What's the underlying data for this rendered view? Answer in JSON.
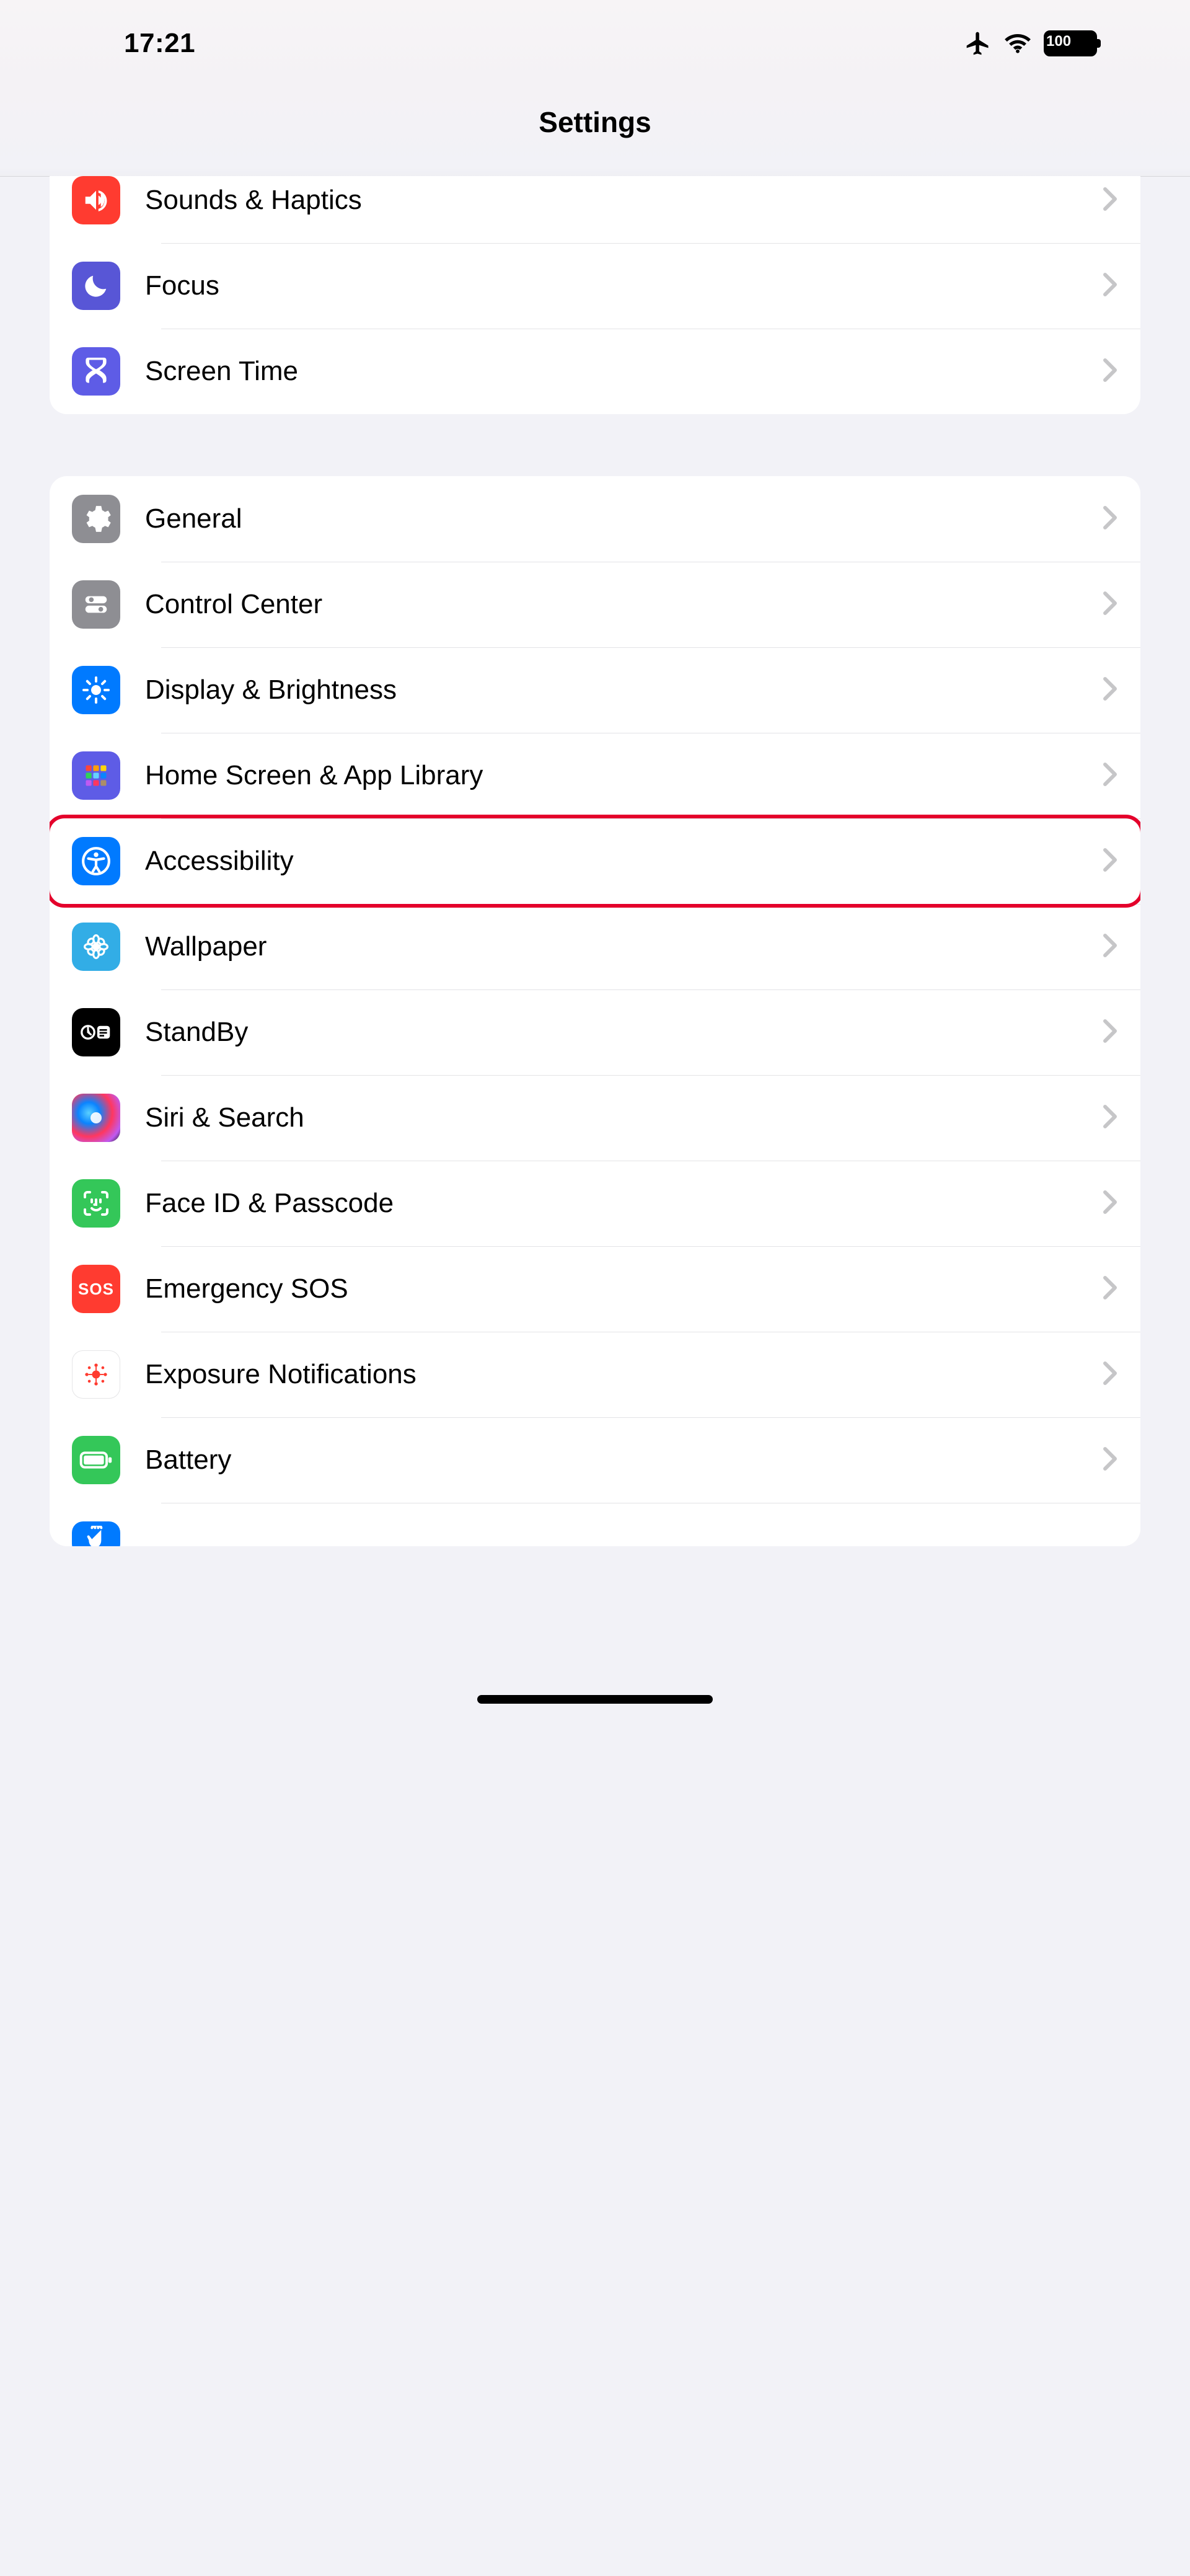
{
  "status": {
    "time": "17:21",
    "battery": "100"
  },
  "header": {
    "title": "Settings"
  },
  "group1": {
    "sounds": {
      "label": "Sounds & Haptics"
    },
    "focus": {
      "label": "Focus"
    },
    "screentime": {
      "label": "Screen Time"
    }
  },
  "group2": {
    "general": {
      "label": "General"
    },
    "controlcenter": {
      "label": "Control Center"
    },
    "display": {
      "label": "Display & Brightness"
    },
    "homescreen": {
      "label": "Home Screen & App Library"
    },
    "accessibility": {
      "label": "Accessibility"
    },
    "wallpaper": {
      "label": "Wallpaper"
    },
    "standby": {
      "label": "StandBy"
    },
    "siri": {
      "label": "Siri & Search"
    },
    "faceid": {
      "label": "Face ID & Passcode"
    },
    "sos": {
      "label": "Emergency SOS",
      "icon_text": "SOS"
    },
    "exposure": {
      "label": "Exposure Notifications"
    },
    "battery": {
      "label": "Battery"
    },
    "privacy": {
      "label": ""
    }
  }
}
